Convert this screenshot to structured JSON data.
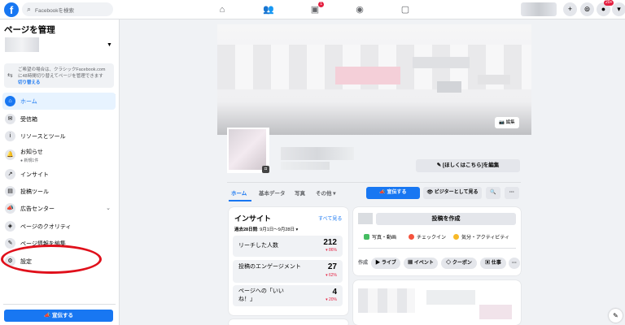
{
  "topbar": {
    "logo": "f",
    "search_placeholder": "Facebookを検索",
    "nav_icons": [
      "home-icon",
      "friends-icon",
      "watch-icon",
      "groups-icon",
      "gaming-icon"
    ],
    "watch_badge": "1",
    "notification_badge": "20+",
    "plus_glyph": "+",
    "menu_caret": "▾"
  },
  "sidebar": {
    "title": "ページを管理",
    "classic_notice": {
      "line1": "ご希望の場合は、クラシックFacebook.com",
      "line2": "に48時間切り替えてページを管理できます",
      "link": "切り替える"
    },
    "items": [
      {
        "label": "ホーム",
        "icon": "home-icon",
        "glyph": "⌂",
        "active": true
      },
      {
        "label": "受信箱",
        "icon": "inbox-icon",
        "glyph": "✉"
      },
      {
        "label": "リソースとツール",
        "icon": "info-icon",
        "glyph": "i"
      },
      {
        "label": "お知らせ",
        "icon": "bell-icon",
        "glyph": "🔔",
        "sub": "● 新規1件"
      },
      {
        "label": "インサイト",
        "icon": "insights-icon",
        "glyph": "↗"
      },
      {
        "label": "投稿ツール",
        "icon": "publishing-icon",
        "glyph": "▤"
      },
      {
        "label": "広告センター",
        "icon": "megaphone-icon",
        "glyph": "📣",
        "chevron": "⌄"
      },
      {
        "label": "ページのクオリティ",
        "icon": "shield-icon",
        "glyph": "◈"
      },
      {
        "label": "ページ情報を編集",
        "icon": "pencil-icon",
        "glyph": "✎"
      },
      {
        "label": "設定",
        "icon": "gear-icon",
        "glyph": "⚙"
      }
    ],
    "promote_button": "📣 宣伝する"
  },
  "profile": {
    "cover_edit": "📷 編集",
    "edit_button": "✎ [ほしくはこちら]を編集"
  },
  "tabs": {
    "items": [
      "ホーム",
      "基本データ",
      "写真",
      "その他 ▾"
    ],
    "promote": "📣 宣伝する",
    "visitor_view": "👁 ビジターとして見る",
    "search_glyph": "🔍",
    "more_glyph": "···"
  },
  "insights": {
    "title": "インサイト",
    "see_all": "すべて見る",
    "period_label": "過去28日間",
    "period_range": ": 9月1日〜9月28日 ▾",
    "stats": [
      {
        "label": "リーチした人数",
        "value": "212",
        "change": "▾ 86%"
      },
      {
        "label": "投稿のエンゲージメント",
        "value": "27",
        "change": "▾ 62%"
      },
      {
        "label": "ページへの「いいね！」",
        "value": "4",
        "change": "▾ 20%"
      }
    ]
  },
  "create": {
    "create_post": "投稿を作成",
    "quick_actions": [
      "写真・動画",
      "チェックイン",
      "気分・アクティビティ"
    ],
    "create_label": "作成",
    "chips": [
      "▶ ライブ",
      "▦ イベント",
      "◇ クーポン",
      "▣ 仕事",
      "···"
    ]
  },
  "colors": {
    "brand": "#1877f2",
    "annotation": "#e0101b"
  }
}
